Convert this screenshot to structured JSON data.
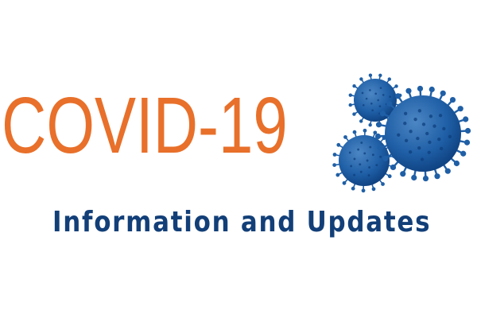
{
  "banner": {
    "title": "COVID-19",
    "subtitle": "Information and Updates"
  },
  "illustration": {
    "icon": "coronavirus-cluster-icon"
  },
  "colors": {
    "title": "#e8702a",
    "subtitle": "#123f78",
    "virus_body": "#1f5fa6",
    "virus_dark": "#0d3f7e",
    "virus_light": "#4c86c4",
    "background": "#ffffff"
  }
}
